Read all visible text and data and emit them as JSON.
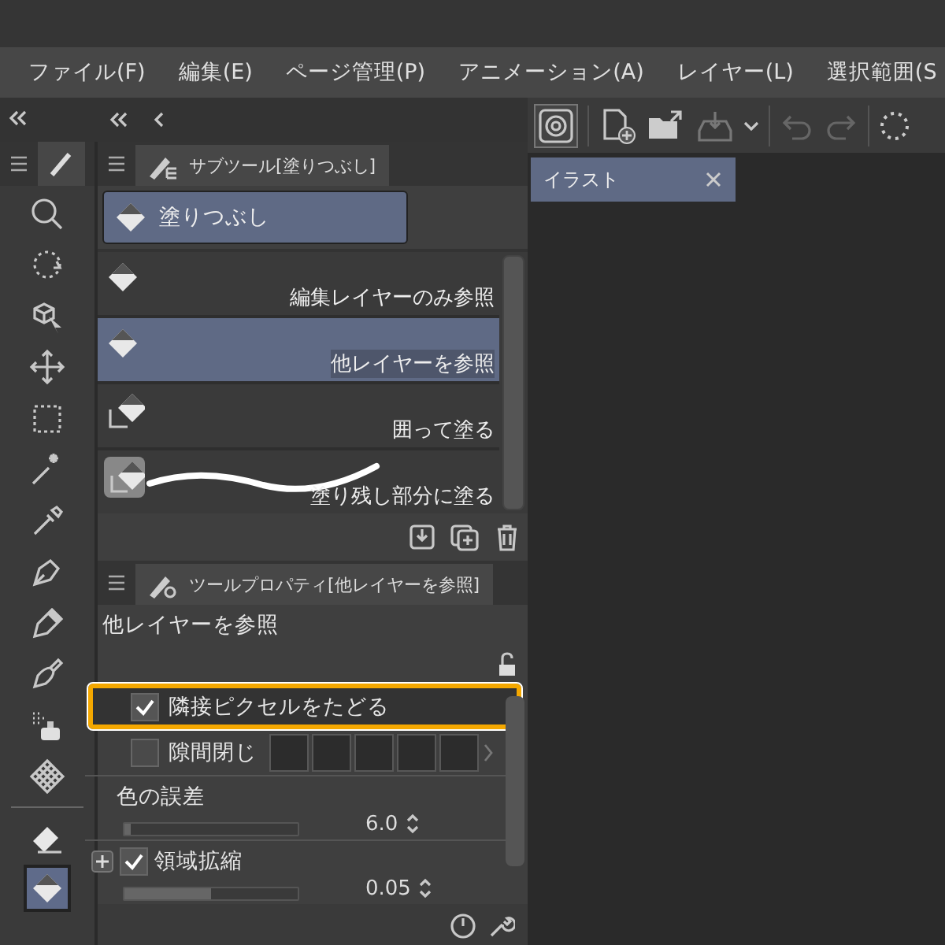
{
  "menu": [
    "ファイル(F)",
    "編集(E)",
    "ページ管理(P)",
    "アニメーション(A)",
    "レイヤー(L)",
    "選択範囲(S"
  ],
  "toolbar": {
    "tools": [
      {
        "selected": false
      },
      {
        "selected": false
      },
      {
        "selected": false
      },
      {
        "selected": false
      },
      {
        "selected": false
      },
      {
        "selected": false
      },
      {
        "selected": false
      },
      {
        "selected": false
      },
      {
        "selected": false
      },
      {
        "selected": false
      },
      {
        "selected": false
      },
      {
        "selected": false
      },
      {
        "selected": false
      },
      {
        "selected": true
      }
    ]
  },
  "subtool": {
    "tab": "サブツール[塗りつぶし]",
    "group": {
      "label": "塗りつぶし",
      "selected": true
    },
    "items": [
      {
        "label": "編集レイヤーのみ参照",
        "kind": "plain",
        "selected": false
      },
      {
        "label": "他レイヤーを参照",
        "kind": "plain",
        "selected": true
      },
      {
        "label": "囲って塗る",
        "kind": "enclose",
        "selected": false
      },
      {
        "label": "塗り残し部分に塗る",
        "kind": "stroke",
        "selected": false
      }
    ]
  },
  "properties": {
    "tab": "ツールプロパティ[他レイヤーを参照]",
    "title": "他レイヤーを参照",
    "rows": [
      {
        "kind": "check",
        "label": "隣接ピクセルをたどる",
        "checked": true,
        "highlighted": true
      },
      {
        "kind": "gap",
        "label": "隙間閉じ",
        "checked": false,
        "highlighted": false
      },
      {
        "kind": "slider",
        "label": "色の誤差",
        "value": "6.0",
        "level": 0.04
      },
      {
        "kind": "check-slider",
        "label": "領域拡縮",
        "checked": true,
        "value": "0.05",
        "level": 0.5
      }
    ]
  },
  "canvas": {
    "tab": "イラスト"
  }
}
